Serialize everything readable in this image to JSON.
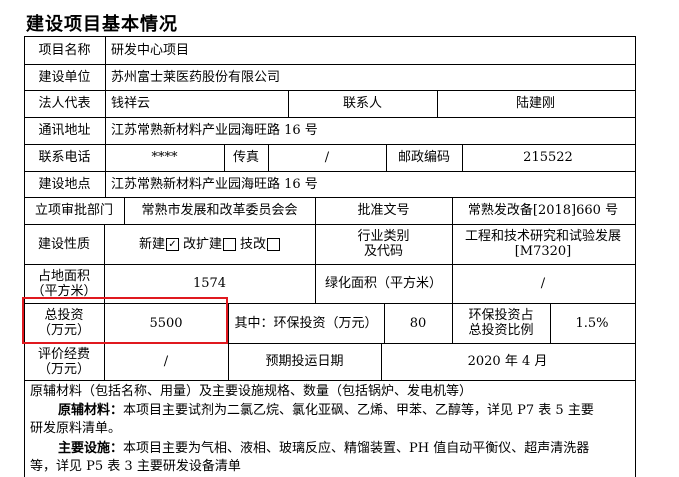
{
  "page_title": "建设项目基本情况",
  "rows": {
    "project_name": {
      "label": "项目名称",
      "value": "研发中心项目"
    },
    "builder": {
      "label": "建设单位",
      "value": "苏州富士莱医药股份有限公司"
    },
    "legal": {
      "label": "法人代表",
      "value": "钱祥云",
      "contact_label": "联系人",
      "contact_value": "陆建刚"
    },
    "address": {
      "label": "通讯地址",
      "value": "江苏常熟新材料产业园海旺路 16 号"
    },
    "phone": {
      "label": "联系电话",
      "value": "****",
      "fax_label": "传真",
      "fax_value": "/",
      "zip_label": "邮政编码",
      "zip_value": "215522"
    },
    "site": {
      "label": "建设地点",
      "value": "江苏常熟新材料产业园海旺路 16 号"
    },
    "approval": {
      "label": "立项审批部门",
      "value": "常熟市发展和改革委员会会",
      "doc_label": "批准文号",
      "doc_value": "常熟发改备[2018]660 号"
    },
    "nature": {
      "label": "建设性质",
      "opt_new": "新建",
      "opt_new_mark": "✓",
      "opt_expand": "改扩建",
      "opt_tech": "技改",
      "industry_label_1": "行业类别",
      "industry_label_2": "及代码",
      "industry_value_1": "工程和技术研究和试验发展",
      "industry_value_2": "[M7320]"
    },
    "area": {
      "label_1": "占地面积",
      "label_2": "（平方米）",
      "value": "1574",
      "green_label": "绿化面积（平方米）",
      "green_value": "/"
    },
    "investment": {
      "label_1": "总投资",
      "label_2": "（万元）",
      "value": "5500",
      "env_label": "其中：环保投资（万元）",
      "env_value": "80",
      "ratio_label_1": "环保投资占",
      "ratio_label_2": "总投资比例",
      "ratio_value": "1.5%"
    },
    "evaluation": {
      "label_1": "评价经费",
      "label_2": "（万元）",
      "value": "/",
      "date_label": "预期投运日期",
      "date_value": "2020 年 4 月"
    }
  },
  "notes": {
    "heading": "原辅材料（包括名称、用量）及主要设施规格、数量（包括锅炉、发电机等）",
    "materials_label": "原辅材料：",
    "materials_text_1": "本项目主要试剂为二氯乙烷、氯化亚砜、乙烯、甲苯、乙醇等，详见 P7 表 5 主要",
    "materials_text_2": "研发原料清单。",
    "equipment_label": "主要设施：",
    "equipment_text_1": "本项目主要为气相、液相、玻璃反应、精馏装置、PH 值自动平衡仪、超声清洗器",
    "equipment_text_2": "等，详见 P5 表 3 主要研发设备清单"
  }
}
